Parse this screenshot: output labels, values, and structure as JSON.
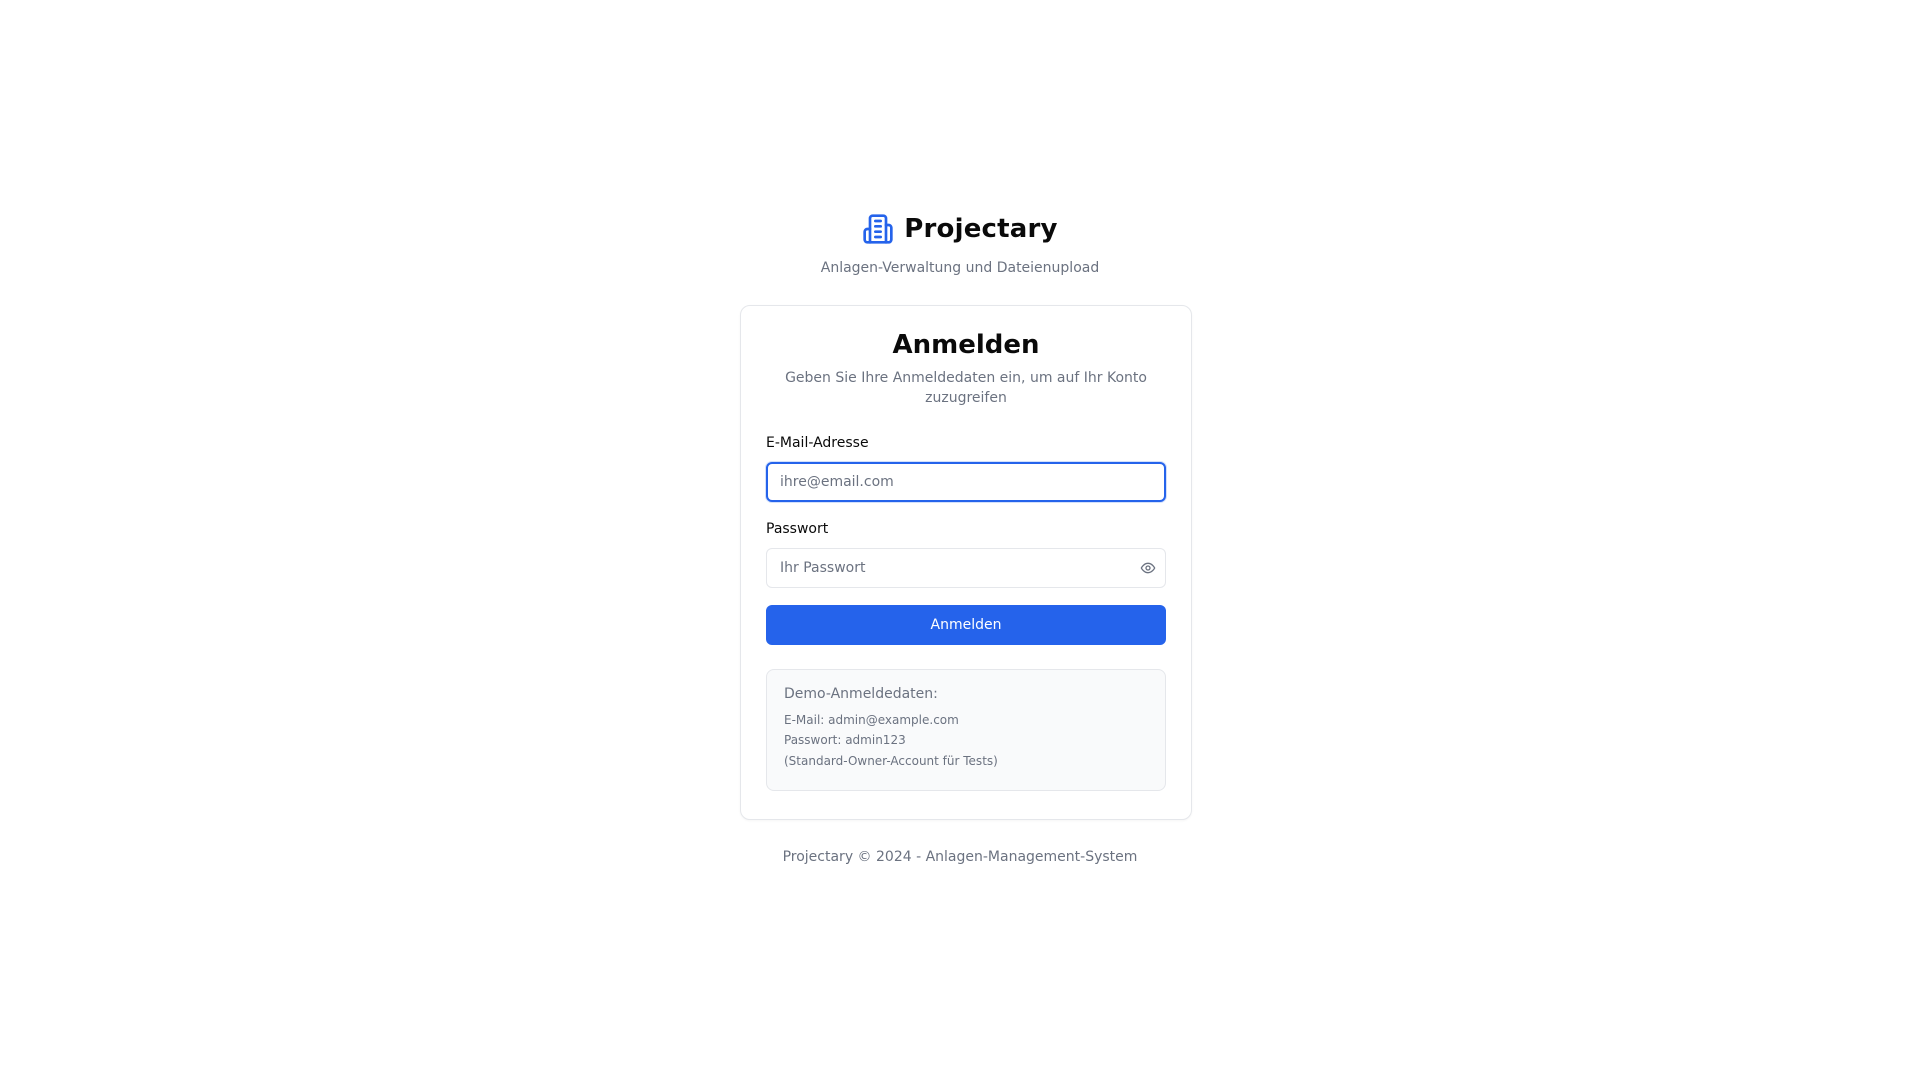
{
  "brand": {
    "name": "Projectary",
    "subtitle": "Anlagen-Verwaltung und Dateienupload",
    "icon": "building-icon",
    "accent_color": "#2563eb"
  },
  "login": {
    "title": "Anmelden",
    "description": "Geben Sie Ihre Anmeldedaten ein, um auf Ihr Konto zuzugreifen",
    "email_label": "E-Mail-Adresse",
    "email_placeholder": "ihre@email.com",
    "email_value": "",
    "password_label": "Passwort",
    "password_placeholder": "Ihr Passwort",
    "password_value": "",
    "password_toggle_icon": "eye-icon",
    "submit_label": "Anmelden",
    "button_color": "#2563eb"
  },
  "demo": {
    "title": "Demo-Anmeldedaten:",
    "email_line": "E-Mail: admin@example.com",
    "password_line": "Passwort: admin123",
    "note": "(Standard-Owner-Account für Tests)"
  },
  "footer": {
    "text": "Projectary © 2024 - Anlagen-Management-System"
  }
}
